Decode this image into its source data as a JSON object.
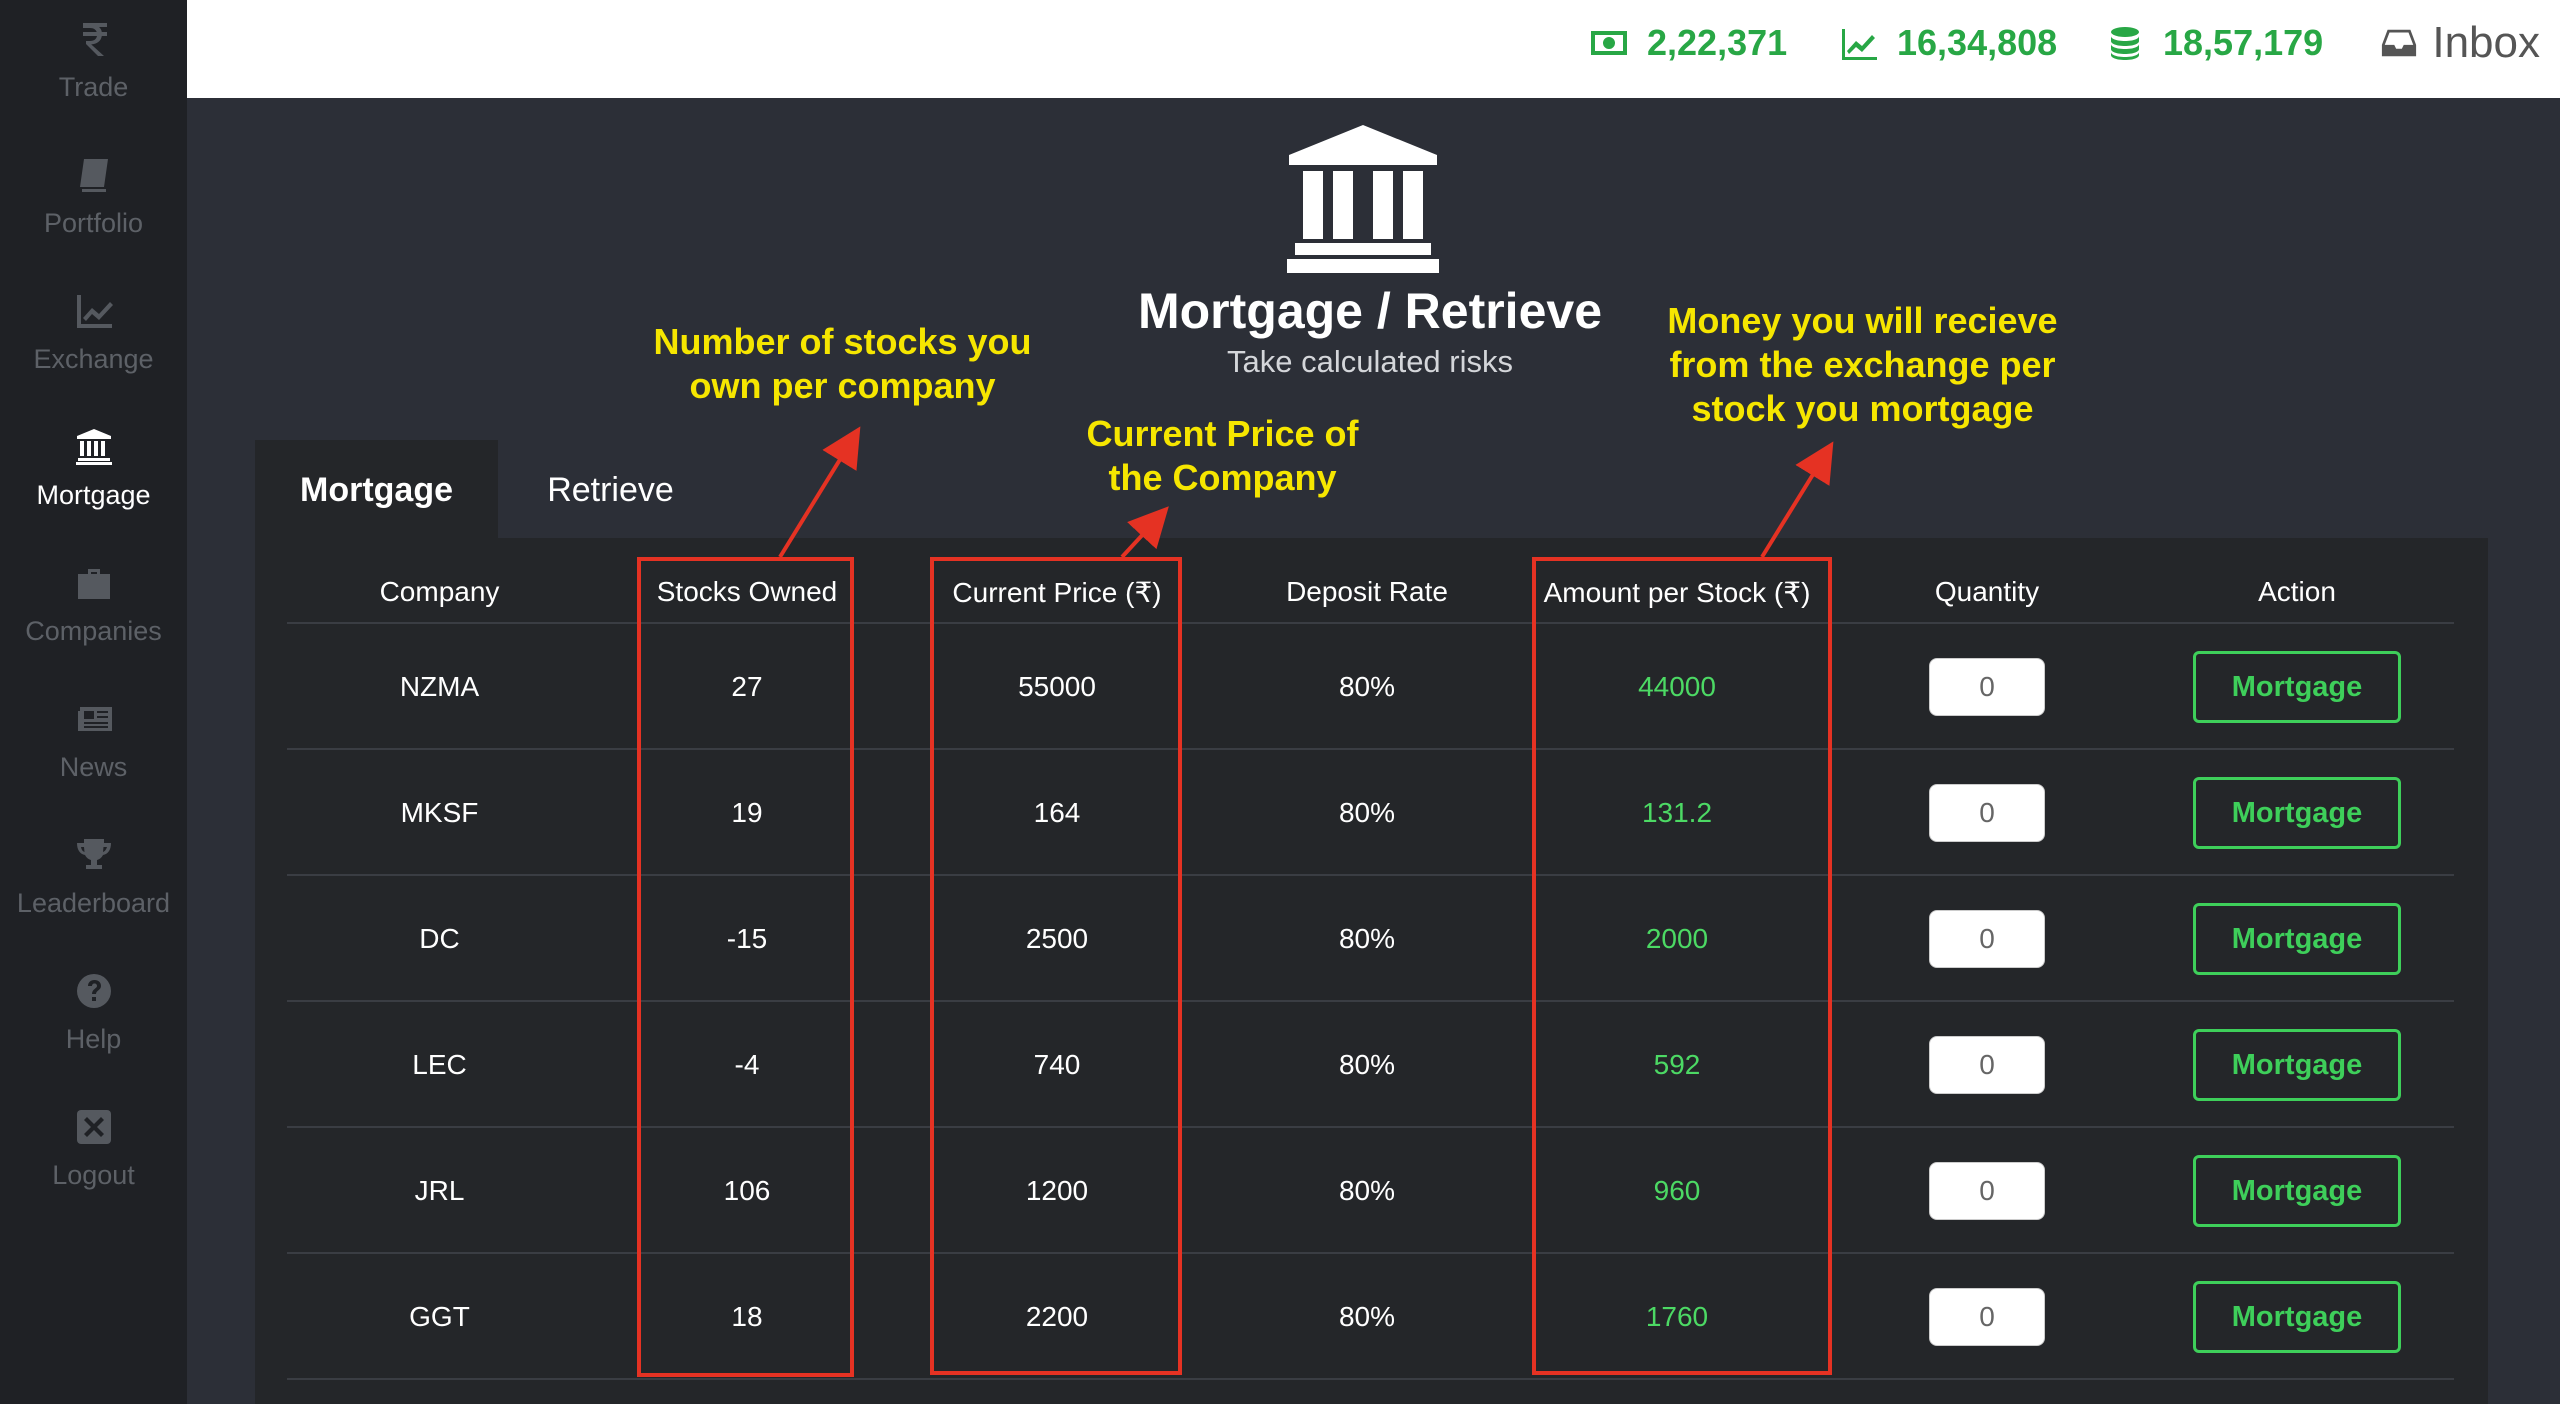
{
  "sidebar": {
    "items": [
      {
        "label": "Trade",
        "icon": "rupee-icon",
        "active": false
      },
      {
        "label": "Portfolio",
        "icon": "book-icon",
        "active": false
      },
      {
        "label": "Exchange",
        "icon": "line-chart-icon",
        "active": false
      },
      {
        "label": "Mortgage",
        "icon": "bank-icon",
        "active": true
      },
      {
        "label": "Companies",
        "icon": "briefcase-icon",
        "active": false
      },
      {
        "label": "News",
        "icon": "newspaper-icon",
        "active": false
      },
      {
        "label": "Leaderboard",
        "icon": "trophy-icon",
        "active": false
      },
      {
        "label": "Help",
        "icon": "question-circle-icon",
        "active": false
      },
      {
        "label": "Logout",
        "icon": "close-box-icon",
        "active": false
      }
    ]
  },
  "topbar": {
    "cash": "2,22,371",
    "stock_worth": "16,34,808",
    "total_worth": "18,57,179",
    "inbox_label": "Inbox"
  },
  "header": {
    "title": "Mortgage / Retrieve",
    "subtitle": "Take calculated risks"
  },
  "annotations": {
    "stocks_owned": "Number of stocks you own per company",
    "current_price": "Current Price of the Company",
    "amount_per_stock": "Money you will recieve from the exchange per stock you mortgage"
  },
  "tabs": [
    {
      "label": "Mortgage",
      "active": true
    },
    {
      "label": "Retrieve",
      "active": false
    }
  ],
  "table": {
    "columns": [
      "Company",
      "Stocks Owned",
      "Current Price (₹)",
      "Deposit Rate",
      "Amount per Stock (₹)",
      "Quantity",
      "Action"
    ],
    "rows": [
      {
        "company": "NZMA",
        "stocks_owned": "27",
        "current_price": "55000",
        "deposit_rate": "80%",
        "amount_per_stock": "44000",
        "quantity": "0",
        "action": "Mortgage"
      },
      {
        "company": "MKSF",
        "stocks_owned": "19",
        "current_price": "164",
        "deposit_rate": "80%",
        "amount_per_stock": "131.2",
        "quantity": "0",
        "action": "Mortgage"
      },
      {
        "company": "DC",
        "stocks_owned": "-15",
        "current_price": "2500",
        "deposit_rate": "80%",
        "amount_per_stock": "2000",
        "quantity": "0",
        "action": "Mortgage"
      },
      {
        "company": "LEC",
        "stocks_owned": "-4",
        "current_price": "740",
        "deposit_rate": "80%",
        "amount_per_stock": "592",
        "quantity": "0",
        "action": "Mortgage"
      },
      {
        "company": "JRL",
        "stocks_owned": "106",
        "current_price": "1200",
        "deposit_rate": "80%",
        "amount_per_stock": "960",
        "quantity": "0",
        "action": "Mortgage"
      },
      {
        "company": "GGT",
        "stocks_owned": "18",
        "current_price": "2200",
        "deposit_rate": "80%",
        "amount_per_stock": "1760",
        "quantity": "0",
        "action": "Mortgage"
      }
    ]
  },
  "colors": {
    "accent_green": "#28a745",
    "button_green": "#3ecf5a",
    "annotation_yellow": "#f6e600",
    "highlight_red": "#e53223"
  }
}
